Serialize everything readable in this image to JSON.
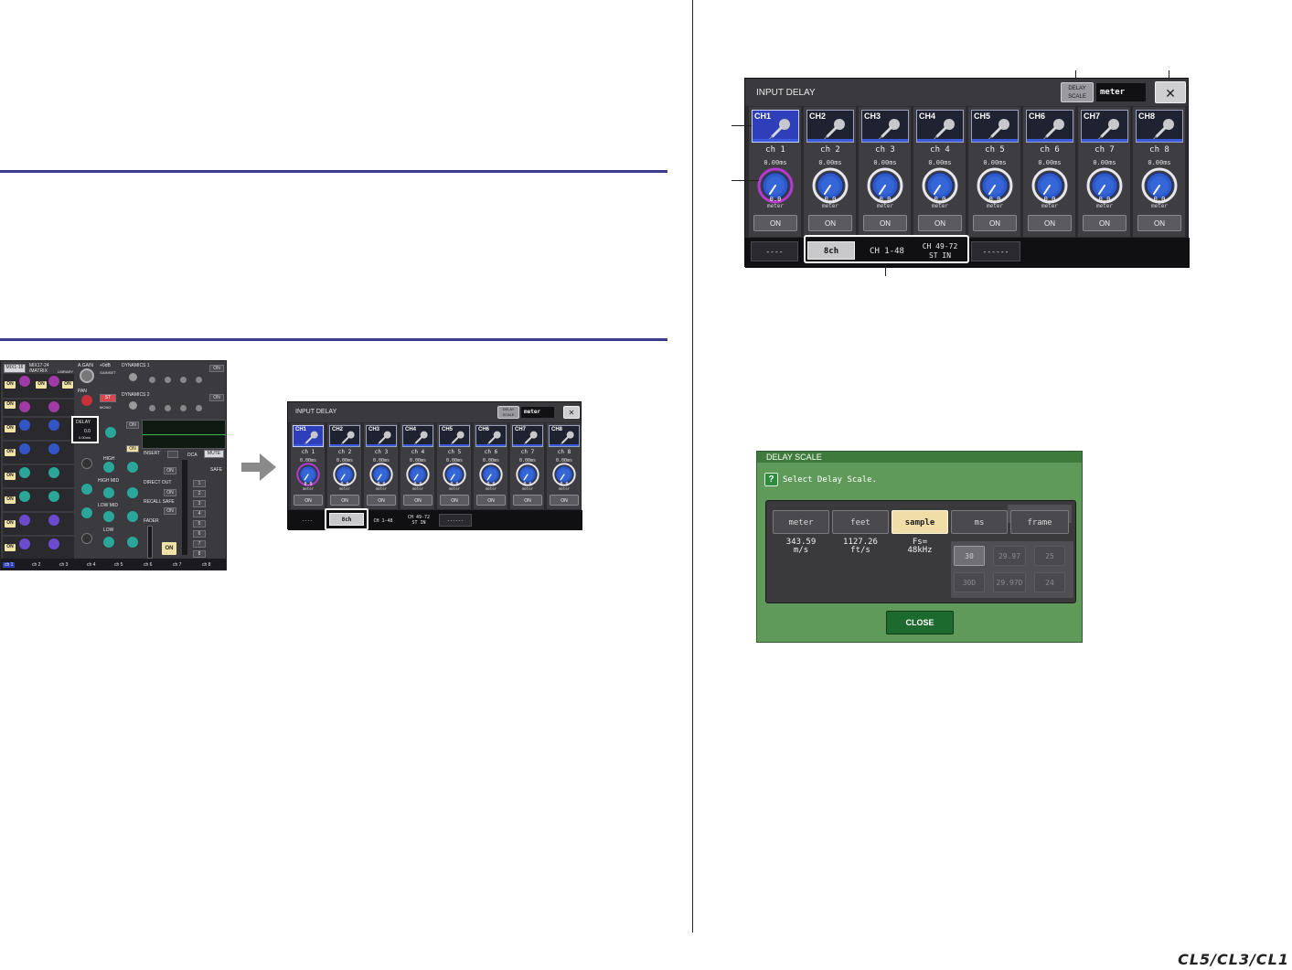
{
  "input_delay": {
    "title": "INPUT DELAY",
    "delay_scale_label_1": "DELAY",
    "delay_scale_label_2": "SCALE",
    "delay_scale_value": "meter",
    "close_symbol": "✕",
    "channels": [
      {
        "button": "CH1",
        "name": "ch 1",
        "time": "0.00ms",
        "value": "0.0",
        "unit": "meter",
        "on": "ON",
        "selected": true
      },
      {
        "button": "CH2",
        "name": "ch 2",
        "time": "0.00ms",
        "value": "0.0",
        "unit": "meter",
        "on": "ON",
        "selected": false
      },
      {
        "button": "CH3",
        "name": "ch 3",
        "time": "0.00ms",
        "value": "0.0",
        "unit": "meter",
        "on": "ON",
        "selected": false
      },
      {
        "button": "CH4",
        "name": "ch 4",
        "time": "0.00ms",
        "value": "0.0",
        "unit": "meter",
        "on": "ON",
        "selected": false
      },
      {
        "button": "CH5",
        "name": "ch 5",
        "time": "0.00ms",
        "value": "0.0",
        "unit": "meter",
        "on": "ON",
        "selected": false
      },
      {
        "button": "CH6",
        "name": "ch 6",
        "time": "0.00ms",
        "value": "0.0",
        "unit": "meter",
        "on": "ON",
        "selected": false
      },
      {
        "button": "CH7",
        "name": "ch 7",
        "time": "0.00ms",
        "value": "0.0",
        "unit": "meter",
        "on": "ON",
        "selected": false
      },
      {
        "button": "CH8",
        "name": "ch 8",
        "time": "0.00ms",
        "value": "0.0",
        "unit": "meter",
        "on": "ON",
        "selected": false
      }
    ],
    "bottom": {
      "left_dash": "----",
      "tab_8ch": "8ch",
      "tab_ch1_48": "CH 1-48",
      "tab_ch49_72_line1": "CH 49-72",
      "tab_ch49_72_line2": "ST IN",
      "right_dash": "------"
    }
  },
  "delay_scale_dialog": {
    "title": "DELAY SCALE",
    "help_symbol": "?",
    "prompt": "Select Delay Scale.",
    "options": [
      "meter",
      "feet",
      "sample",
      "ms",
      "frame"
    ],
    "selected": "sample",
    "meter_info_1": "343.59",
    "meter_info_2": "m/s",
    "feet_info_1": "1127.26",
    "feet_info_2": "ft/s",
    "sample_info_1": "Fs=",
    "sample_info_2": "48kHz",
    "frame_rates": [
      "30",
      "29.97",
      "25",
      "30D",
      "29.97D",
      "24"
    ],
    "close": "CLOSE"
  },
  "mixer": {
    "header_tab": "MIX1-16",
    "mix_label": "MIX17-24",
    "matrix_label": "/MATRIX",
    "library_label": "LIBRARY",
    "again_label": "A.GAIN",
    "again_value": "+0dB",
    "dynamics1": "DYNAMICS 1",
    "dynamics2": "DYNAMICS 2",
    "pan_label": "PAN",
    "st_label": "ST",
    "mono_label": "MONO",
    "delay_label": "DELAY",
    "delay_value_1": "0.0",
    "delay_value_2": "0.00ms",
    "insert_label": "INSERT",
    "dca_label": "DCA",
    "mute_label": "MUTE",
    "safe_label": "SAFE",
    "direct_out_label": "DIRECT OUT",
    "recall_safe_label": "RECALL SAFE",
    "fader_label": "FADER",
    "high_label": "HIGH",
    "high_mid_label": "HIGH MID",
    "low_mid_label": "LOW MID",
    "low_label": "LOW",
    "on_label": "ON",
    "dca_numbers": [
      "1",
      "2",
      "3",
      "4",
      "5",
      "6",
      "7",
      "8"
    ],
    "channel_names": [
      "ch 1",
      "ch 2",
      "ch 3",
      "ch 4",
      "ch 5",
      "ch 6",
      "ch 7",
      "ch 8"
    ]
  },
  "brand_footer": "CL5/CL3/CL1",
  "colors": {
    "rule": "#3c3c8c",
    "selected_channel": "#2e3fb9",
    "knob_blue": "#2d59c9",
    "knob_selected_ring": "#b43bd0",
    "dialog_green": "#5f9a5b",
    "sample_selected": "#f0dda8",
    "callout_frame": "#ffffff"
  }
}
